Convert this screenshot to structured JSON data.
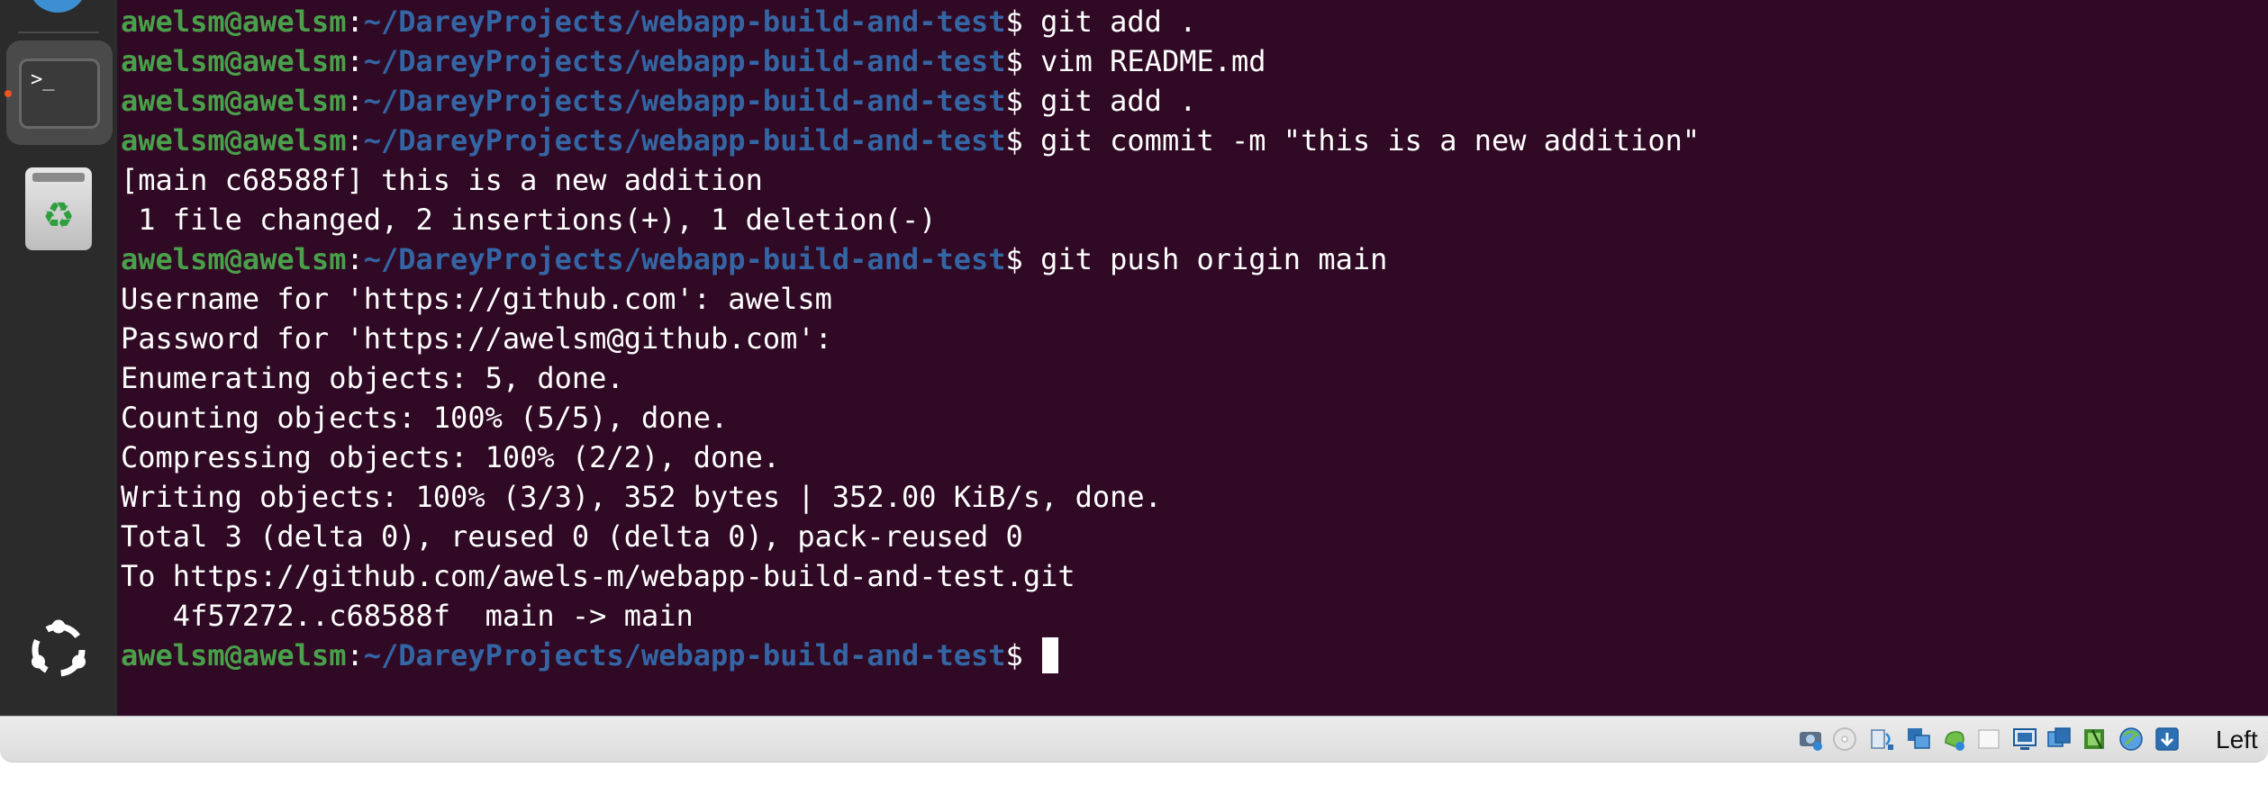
{
  "dock": {
    "items": [
      {
        "name": "terminal",
        "icon_text": ">_"
      },
      {
        "name": "trash",
        "icon_text": "♻"
      },
      {
        "name": "show-apps",
        "icon_text": ""
      }
    ]
  },
  "terminal": {
    "prompt": {
      "user": "awelsm@awelsm",
      "colon": ":",
      "path": "~/DareyProjects/webapp-build-and-test",
      "dollar": "$ "
    },
    "lines": [
      {
        "type": "prompt",
        "cmd": "git add ."
      },
      {
        "type": "prompt",
        "cmd": "vim README.md"
      },
      {
        "type": "prompt",
        "cmd": "git add ."
      },
      {
        "type": "prompt",
        "cmd": "git commit -m \"this is a new addition\""
      },
      {
        "type": "output",
        "text": "[main c68588f] this is a new addition"
      },
      {
        "type": "output",
        "text": " 1 file changed, 2 insertions(+), 1 deletion(-)"
      },
      {
        "type": "prompt",
        "cmd": "git push origin main"
      },
      {
        "type": "output",
        "text": "Username for 'https://github.com': awelsm"
      },
      {
        "type": "output",
        "text": "Password for 'https://awelsm@github.com':"
      },
      {
        "type": "output",
        "text": "Enumerating objects: 5, done."
      },
      {
        "type": "output",
        "text": "Counting objects: 100% (5/5), done."
      },
      {
        "type": "output",
        "text": "Compressing objects: 100% (2/2), done."
      },
      {
        "type": "output",
        "text": "Writing objects: 100% (3/3), 352 bytes | 352.00 KiB/s, done."
      },
      {
        "type": "output",
        "text": "Total 3 (delta 0), reused 0 (delta 0), pack-reused 0"
      },
      {
        "type": "output",
        "text": "To https://github.com/awels-m/webapp-build-and-test.git"
      },
      {
        "type": "output",
        "text": "   4f57272..c68588f  main -> main"
      },
      {
        "type": "prompt",
        "cmd": "",
        "cursor": true
      }
    ],
    "colors": {
      "background": "#300a24",
      "user": "#4aa04a",
      "path": "#3465a4",
      "text": "#ffffff"
    }
  },
  "statusbar": {
    "icons": [
      "hard-disk-icon",
      "optical-drive-icon",
      "audio-icon",
      "network-icon",
      "usb-icon",
      "shared-folder-icon",
      "display-icon",
      "screen-recording-icon",
      "cpu-icon",
      "mouse-integration-icon",
      "keyboard-icon"
    ],
    "host_key": "Left ⌘"
  }
}
